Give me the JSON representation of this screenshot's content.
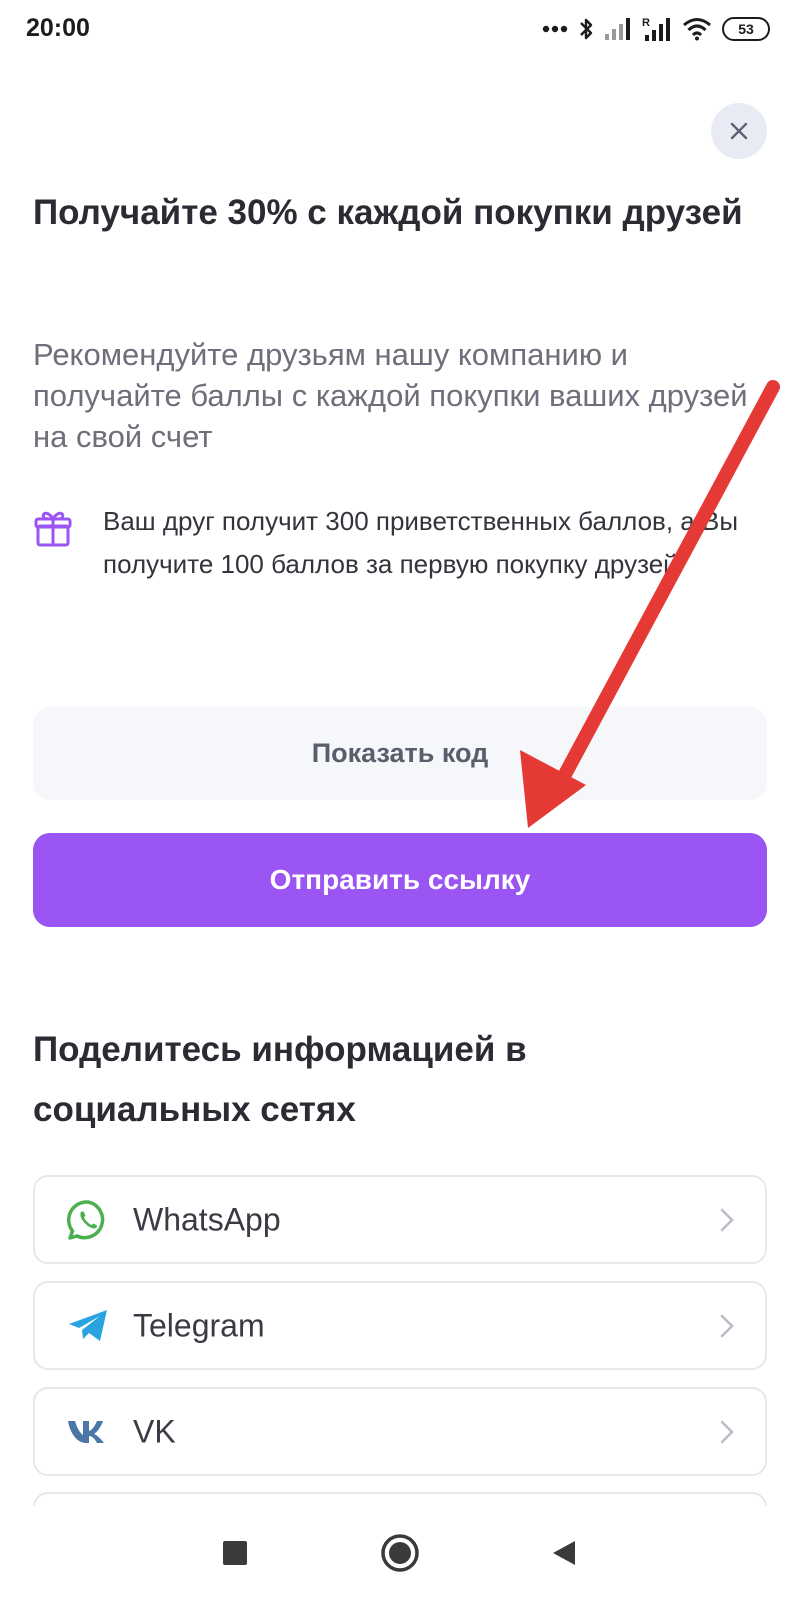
{
  "status_bar": {
    "time": "20:00",
    "battery": "53",
    "icons": [
      "dots-icon",
      "bluetooth-icon",
      "signal-icon",
      "signal-roaming-icon",
      "wifi-icon",
      "battery-icon"
    ]
  },
  "close_icon": "close-icon",
  "title": "Получайте 30% с каждой покупки друзей",
  "description": "Рекомендуйте друзьям нашу компанию и получайте баллы с каждой покупки ваших друзей на свой счет",
  "gift": {
    "icon": "gift-icon",
    "text": "Ваш друг получит 300 приветственных баллов, а Вы получите 100 баллов за первую покупку друзей"
  },
  "buttons": {
    "show_code": "Показать код",
    "send_link": "Отправить ссылку"
  },
  "share": {
    "title": "Поделитесь информацией в социальных сетях",
    "items": [
      {
        "label": "WhatsApp",
        "icon": "whatsapp-icon"
      },
      {
        "label": "Telegram",
        "icon": "telegram-icon"
      },
      {
        "label": "VK",
        "icon": "vk-icon"
      }
    ]
  },
  "colors": {
    "accent": "#9b55f2",
    "arrow": "#e53935",
    "whatsapp": "#4caf50",
    "telegram": "#2aa3e0",
    "vk": "#4a76a8"
  },
  "nav": [
    "recent-apps-icon",
    "home-icon",
    "back-icon"
  ]
}
